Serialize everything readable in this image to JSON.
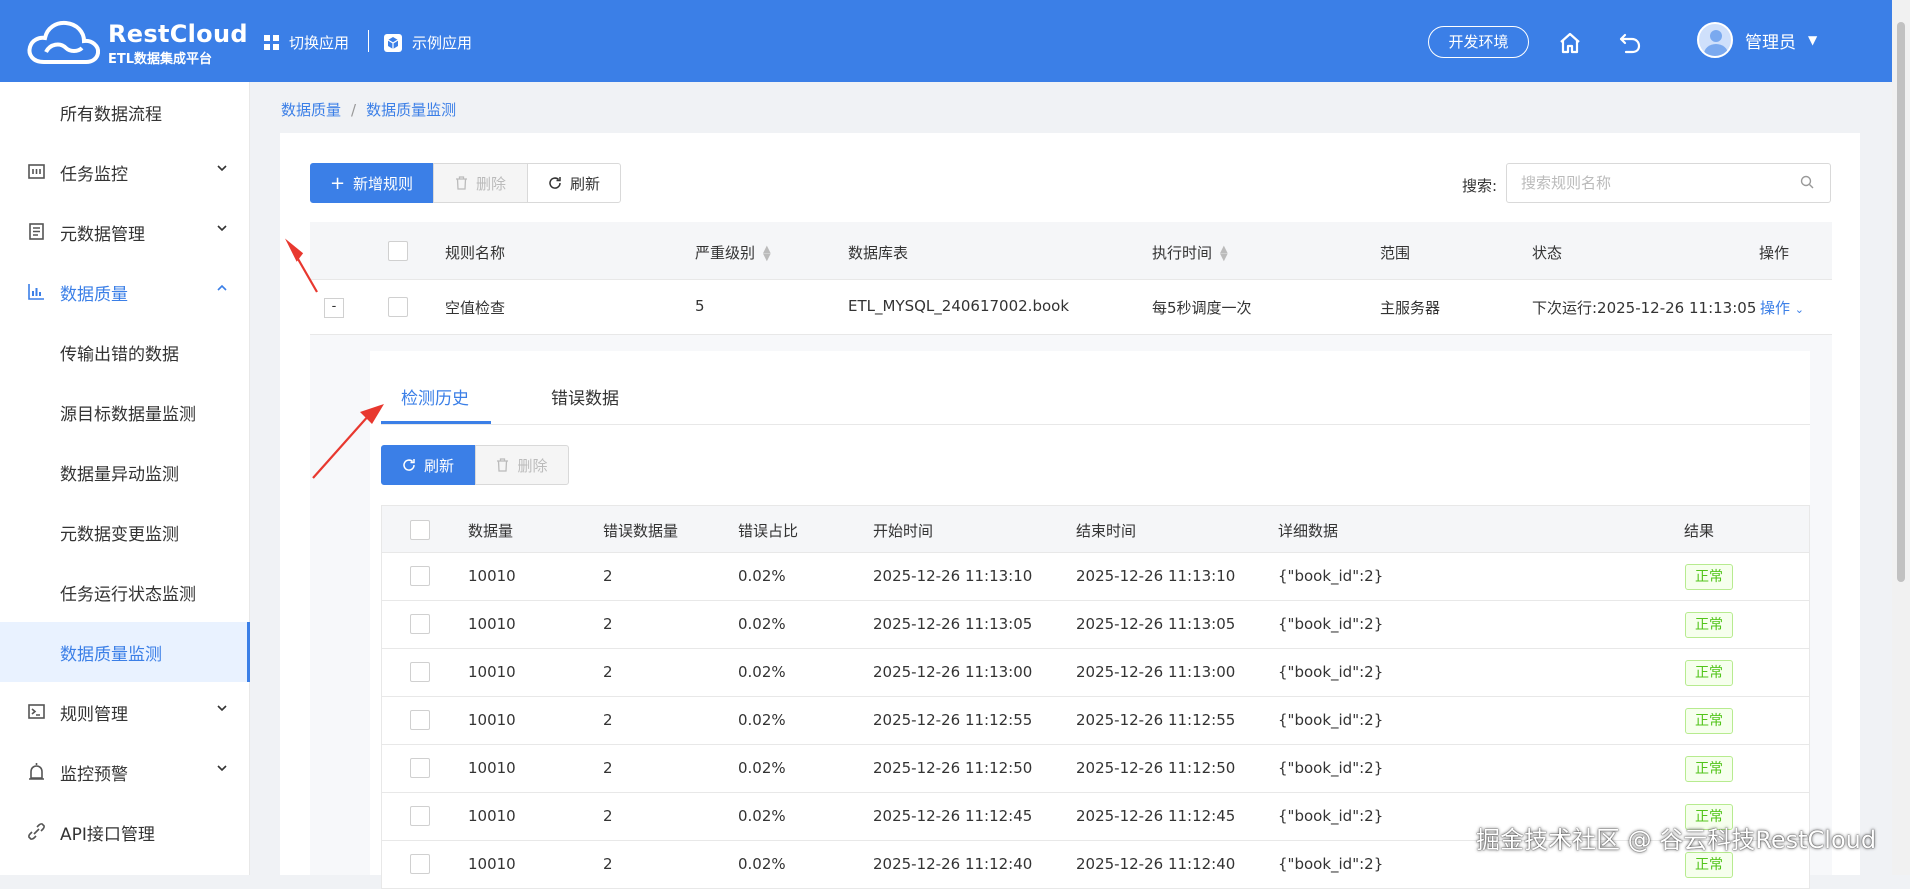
{
  "header": {
    "brand_name": "RestCloud",
    "brand_sub": "ETL数据集成平台",
    "switch_app": "切换应用",
    "demo_app": "示例应用",
    "env": "开发环境",
    "user": "管理员"
  },
  "sidebar": {
    "items": [
      {
        "label": "所有数据流程",
        "icon": "none"
      },
      {
        "label": "任务监控",
        "icon": "monitor-icon"
      },
      {
        "label": "元数据管理",
        "icon": "metadata-icon"
      },
      {
        "label": "数据质量",
        "icon": "chart-icon"
      },
      {
        "label": "传输出错的数据"
      },
      {
        "label": "源目标数据量监测"
      },
      {
        "label": "数据量异动监测"
      },
      {
        "label": "元数据变更监测"
      },
      {
        "label": "任务运行状态监测"
      },
      {
        "label": "数据质量监测"
      },
      {
        "label": "规则管理",
        "icon": "terminal-icon"
      },
      {
        "label": "监控预警",
        "icon": "alarm-icon"
      },
      {
        "label": "API接口管理",
        "icon": "api-icon"
      }
    ]
  },
  "breadcrumb": {
    "level1": "数据质量",
    "sep": "/",
    "level2": "数据质量监测"
  },
  "toolbar": {
    "add": "新增规则",
    "delete": "删除",
    "refresh": "刷新",
    "search_label": "搜索:",
    "search_placeholder": "搜索规则名称"
  },
  "rules_table": {
    "columns": [
      "规则名称",
      "严重级别",
      "数据库表",
      "执行时间",
      "范围",
      "状态",
      "操作"
    ],
    "row": {
      "expand": "-",
      "name": "空值检查",
      "level": "5",
      "table": "ETL_MYSQL_240617002.book",
      "exec_time": "每5秒调度一次",
      "scope": "主服务器",
      "status": "下次运行:2025-12-26 11:13:05",
      "action": "操作"
    }
  },
  "detail": {
    "tabs": [
      "检测历史",
      "错误数据"
    ],
    "refresh": "刷新",
    "delete": "删除",
    "columns": [
      "数据量",
      "错误数据量",
      "错误占比",
      "开始时间",
      "结束时间",
      "详细数据",
      "结果"
    ],
    "rows": [
      {
        "count": "10010",
        "errors": "2",
        "ratio": "0.02%",
        "start": "2025-12-26 11:13:10",
        "end": "2025-12-26 11:13:10",
        "detail": "{\"book_id\":2}",
        "result": "正常"
      },
      {
        "count": "10010",
        "errors": "2",
        "ratio": "0.02%",
        "start": "2025-12-26 11:13:05",
        "end": "2025-12-26 11:13:05",
        "detail": "{\"book_id\":2}",
        "result": "正常"
      },
      {
        "count": "10010",
        "errors": "2",
        "ratio": "0.02%",
        "start": "2025-12-26 11:13:00",
        "end": "2025-12-26 11:13:00",
        "detail": "{\"book_id\":2}",
        "result": "正常"
      },
      {
        "count": "10010",
        "errors": "2",
        "ratio": "0.02%",
        "start": "2025-12-26 11:12:55",
        "end": "2025-12-26 11:12:55",
        "detail": "{\"book_id\":2}",
        "result": "正常"
      },
      {
        "count": "10010",
        "errors": "2",
        "ratio": "0.02%",
        "start": "2025-12-26 11:12:50",
        "end": "2025-12-26 11:12:50",
        "detail": "{\"book_id\":2}",
        "result": "正常"
      },
      {
        "count": "10010",
        "errors": "2",
        "ratio": "0.02%",
        "start": "2025-12-26 11:12:45",
        "end": "2025-12-26 11:12:45",
        "detail": "{\"book_id\":2}",
        "result": "正常"
      },
      {
        "count": "10010",
        "errors": "2",
        "ratio": "0.02%",
        "start": "2025-12-26 11:12:40",
        "end": "2025-12-26 11:12:40",
        "detail": "{\"book_id\":2}",
        "result": "正常"
      }
    ]
  },
  "watermark": "掘金技术社区 @ 谷云科技RestCloud",
  "colors": {
    "primary": "#3b7fe7",
    "success": "#52c41a",
    "arrow": "#e8382f"
  }
}
